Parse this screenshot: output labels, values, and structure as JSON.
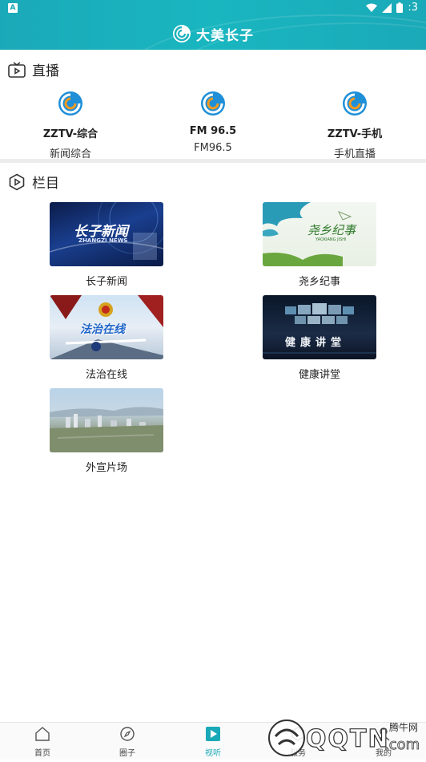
{
  "status": {
    "left_badge": "A",
    "time": ":3"
  },
  "header": {
    "title": "大美长子"
  },
  "live_section": {
    "title": "直播",
    "items": [
      {
        "name": "ZZTV-综合",
        "sub": "新闻综合"
      },
      {
        "name": "FM 96.5",
        "sub": "FM96.5"
      },
      {
        "name": "ZZTV-手机",
        "sub": "手机直播"
      }
    ]
  },
  "column_section": {
    "title": "栏目",
    "items": [
      {
        "label": "长子新闻",
        "thumb_text": "长子新闻",
        "thumb_sub": "ZHANGZI NEWS"
      },
      {
        "label": "尧乡纪事",
        "thumb_text": "尧乡纪事",
        "thumb_sub": "YAOXIANG JISHI"
      },
      {
        "label": "法治在线",
        "thumb_text": "法治在线"
      },
      {
        "label": "健康讲堂",
        "thumb_text": "健康讲堂"
      },
      {
        "label": "外宣片场"
      }
    ]
  },
  "tabbar": {
    "tabs": [
      {
        "label": "首页"
      },
      {
        "label": "圈子"
      },
      {
        "label": "视听"
      },
      {
        "label": "服务"
      },
      {
        "label": "我的"
      }
    ]
  },
  "watermark": {
    "text1": "腾牛网",
    "text2": "QQTN",
    "text3": ".com"
  },
  "colors": {
    "accent": "#1aa9b8",
    "header_bg": "#19b0bc"
  }
}
